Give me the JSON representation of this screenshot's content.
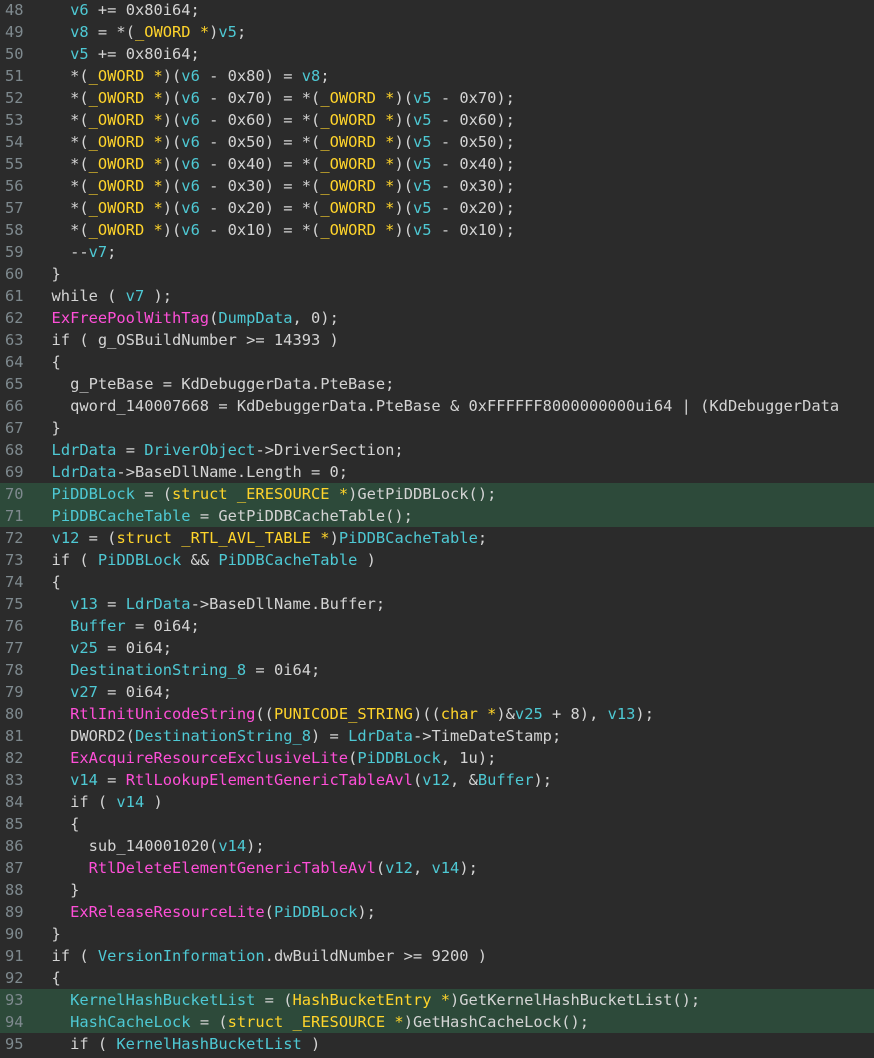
{
  "colors": {
    "background": "#2b2b2b",
    "highlight_row": "#2d4a3a",
    "line_number": "#7f8a8f",
    "plain": "#d4d4d4",
    "variable": "#4ec9d4",
    "global": "#33d4ff",
    "type": "#ffd42b",
    "function": "#ff4fd8"
  },
  "lines": [
    {
      "n": "48",
      "hl": false,
      "tokens": [
        [
          "p",
          "    "
        ],
        [
          "v",
          "v6"
        ],
        [
          "p",
          " += 0x80i64;"
        ]
      ]
    },
    {
      "n": "49",
      "hl": false,
      "tokens": [
        [
          "p",
          "    "
        ],
        [
          "v",
          "v8"
        ],
        [
          "p",
          " = *("
        ],
        [
          "t",
          "_OWORD *"
        ],
        [
          "p",
          ")"
        ],
        [
          "v",
          "v5"
        ],
        [
          "p",
          ";"
        ]
      ]
    },
    {
      "n": "50",
      "hl": false,
      "tokens": [
        [
          "p",
          "    "
        ],
        [
          "v",
          "v5"
        ],
        [
          "p",
          " += 0x80i64;"
        ]
      ]
    },
    {
      "n": "51",
      "hl": false,
      "tokens": [
        [
          "p",
          "    *("
        ],
        [
          "t",
          "_OWORD *"
        ],
        [
          "p",
          ")("
        ],
        [
          "v",
          "v6"
        ],
        [
          "p",
          " - 0x80) = "
        ],
        [
          "v",
          "v8"
        ],
        [
          "p",
          ";"
        ]
      ]
    },
    {
      "n": "52",
      "hl": false,
      "tokens": [
        [
          "p",
          "    *("
        ],
        [
          "t",
          "_OWORD *"
        ],
        [
          "p",
          ")("
        ],
        [
          "v",
          "v6"
        ],
        [
          "p",
          " - 0x70) = *("
        ],
        [
          "t",
          "_OWORD *"
        ],
        [
          "p",
          ")("
        ],
        [
          "v",
          "v5"
        ],
        [
          "p",
          " - 0x70);"
        ]
      ]
    },
    {
      "n": "53",
      "hl": false,
      "tokens": [
        [
          "p",
          "    *("
        ],
        [
          "t",
          "_OWORD *"
        ],
        [
          "p",
          ")("
        ],
        [
          "v",
          "v6"
        ],
        [
          "p",
          " - 0x60) = *("
        ],
        [
          "t",
          "_OWORD *"
        ],
        [
          "p",
          ")("
        ],
        [
          "v",
          "v5"
        ],
        [
          "p",
          " - 0x60);"
        ]
      ]
    },
    {
      "n": "54",
      "hl": false,
      "tokens": [
        [
          "p",
          "    *("
        ],
        [
          "t",
          "_OWORD *"
        ],
        [
          "p",
          ")("
        ],
        [
          "v",
          "v6"
        ],
        [
          "p",
          " - 0x50) = *("
        ],
        [
          "t",
          "_OWORD *"
        ],
        [
          "p",
          ")("
        ],
        [
          "v",
          "v5"
        ],
        [
          "p",
          " - 0x50);"
        ]
      ]
    },
    {
      "n": "55",
      "hl": false,
      "tokens": [
        [
          "p",
          "    *("
        ],
        [
          "t",
          "_OWORD *"
        ],
        [
          "p",
          ")("
        ],
        [
          "v",
          "v6"
        ],
        [
          "p",
          " - 0x40) = *("
        ],
        [
          "t",
          "_OWORD *"
        ],
        [
          "p",
          ")("
        ],
        [
          "v",
          "v5"
        ],
        [
          "p",
          " - 0x40);"
        ]
      ]
    },
    {
      "n": "56",
      "hl": false,
      "tokens": [
        [
          "p",
          "    *("
        ],
        [
          "t",
          "_OWORD *"
        ],
        [
          "p",
          ")("
        ],
        [
          "v",
          "v6"
        ],
        [
          "p",
          " - 0x30) = *("
        ],
        [
          "t",
          "_OWORD *"
        ],
        [
          "p",
          ")("
        ],
        [
          "v",
          "v5"
        ],
        [
          "p",
          " - 0x30);"
        ]
      ]
    },
    {
      "n": "57",
      "hl": false,
      "tokens": [
        [
          "p",
          "    *("
        ],
        [
          "t",
          "_OWORD *"
        ],
        [
          "p",
          ")("
        ],
        [
          "v",
          "v6"
        ],
        [
          "p",
          " - 0x20) = *("
        ],
        [
          "t",
          "_OWORD *"
        ],
        [
          "p",
          ")("
        ],
        [
          "v",
          "v5"
        ],
        [
          "p",
          " - 0x20);"
        ]
      ]
    },
    {
      "n": "58",
      "hl": false,
      "tokens": [
        [
          "p",
          "    *("
        ],
        [
          "t",
          "_OWORD *"
        ],
        [
          "p",
          ")("
        ],
        [
          "v",
          "v6"
        ],
        [
          "p",
          " - 0x10) = *("
        ],
        [
          "t",
          "_OWORD *"
        ],
        [
          "p",
          ")("
        ],
        [
          "v",
          "v5"
        ],
        [
          "p",
          " - 0x10);"
        ]
      ]
    },
    {
      "n": "59",
      "hl": false,
      "tokens": [
        [
          "p",
          "    --"
        ],
        [
          "v",
          "v7"
        ],
        [
          "p",
          ";"
        ]
      ]
    },
    {
      "n": "60",
      "hl": false,
      "tokens": [
        [
          "p",
          "  }"
        ]
      ]
    },
    {
      "n": "61",
      "hl": false,
      "tokens": [
        [
          "p",
          "  while ( "
        ],
        [
          "v",
          "v7"
        ],
        [
          "p",
          " );"
        ]
      ]
    },
    {
      "n": "62",
      "hl": false,
      "tokens": [
        [
          "p",
          "  "
        ],
        [
          "f",
          "ExFreePoolWithTag"
        ],
        [
          "p",
          "("
        ],
        [
          "v",
          "DumpData"
        ],
        [
          "p",
          ", 0);"
        ]
      ]
    },
    {
      "n": "63",
      "hl": false,
      "tokens": [
        [
          "p",
          "  if ( g_OSBuildNumber >= 14393 )"
        ]
      ]
    },
    {
      "n": "64",
      "hl": false,
      "tokens": [
        [
          "p",
          "  {"
        ]
      ]
    },
    {
      "n": "65",
      "hl": false,
      "tokens": [
        [
          "p",
          "    g_PteBase = KdDebuggerData.PteBase;"
        ]
      ]
    },
    {
      "n": "66",
      "hl": false,
      "tokens": [
        [
          "p",
          "    qword_140007668 = KdDebuggerData.PteBase & 0xFFFFFF8000000000ui64 | (KdDebuggerData"
        ]
      ]
    },
    {
      "n": "67",
      "hl": false,
      "tokens": [
        [
          "p",
          "  }"
        ]
      ]
    },
    {
      "n": "68",
      "hl": false,
      "tokens": [
        [
          "p",
          "  "
        ],
        [
          "v",
          "LdrData"
        ],
        [
          "p",
          " = "
        ],
        [
          "v",
          "DriverObject"
        ],
        [
          "p",
          "->DriverSection;"
        ]
      ]
    },
    {
      "n": "69",
      "hl": false,
      "tokens": [
        [
          "p",
          "  "
        ],
        [
          "v",
          "LdrData"
        ],
        [
          "p",
          "->BaseDllName.Length = 0;"
        ]
      ]
    },
    {
      "n": "70",
      "hl": true,
      "tokens": [
        [
          "p",
          "  "
        ],
        [
          "v",
          "PiDDBLock"
        ],
        [
          "p",
          " = ("
        ],
        [
          "t",
          "struct _ERESOURCE *"
        ],
        [
          "p",
          ")GetPiDDBLock();"
        ]
      ]
    },
    {
      "n": "71",
      "hl": true,
      "tokens": [
        [
          "p",
          "  "
        ],
        [
          "v",
          "PiDDBCacheTable"
        ],
        [
          "p",
          " = GetPiDDBCacheTable();"
        ]
      ]
    },
    {
      "n": "72",
      "hl": false,
      "tokens": [
        [
          "p",
          "  "
        ],
        [
          "v",
          "v12"
        ],
        [
          "p",
          " = ("
        ],
        [
          "t",
          "struct _RTL_AVL_TABLE *"
        ],
        [
          "p",
          ")"
        ],
        [
          "v",
          "PiDDBCacheTable"
        ],
        [
          "p",
          ";"
        ]
      ]
    },
    {
      "n": "73",
      "hl": false,
      "tokens": [
        [
          "p",
          "  if ( "
        ],
        [
          "v",
          "PiDDBLock"
        ],
        [
          "p",
          " && "
        ],
        [
          "v",
          "PiDDBCacheTable"
        ],
        [
          "p",
          " )"
        ]
      ]
    },
    {
      "n": "74",
      "hl": false,
      "tokens": [
        [
          "p",
          "  {"
        ]
      ]
    },
    {
      "n": "75",
      "hl": false,
      "tokens": [
        [
          "p",
          "    "
        ],
        [
          "v",
          "v13"
        ],
        [
          "p",
          " = "
        ],
        [
          "v",
          "LdrData"
        ],
        [
          "p",
          "->BaseDllName.Buffer;"
        ]
      ]
    },
    {
      "n": "76",
      "hl": false,
      "tokens": [
        [
          "p",
          "    "
        ],
        [
          "v",
          "Buffer"
        ],
        [
          "p",
          " = 0i64;"
        ]
      ]
    },
    {
      "n": "77",
      "hl": false,
      "tokens": [
        [
          "p",
          "    "
        ],
        [
          "v",
          "v25"
        ],
        [
          "p",
          " = 0i64;"
        ]
      ]
    },
    {
      "n": "78",
      "hl": false,
      "tokens": [
        [
          "p",
          "    "
        ],
        [
          "v",
          "DestinationString_8"
        ],
        [
          "p",
          " = 0i64;"
        ]
      ]
    },
    {
      "n": "79",
      "hl": false,
      "tokens": [
        [
          "p",
          "    "
        ],
        [
          "v",
          "v27"
        ],
        [
          "p",
          " = 0i64;"
        ]
      ]
    },
    {
      "n": "80",
      "hl": false,
      "tokens": [
        [
          "p",
          "    "
        ],
        [
          "f",
          "RtlInitUnicodeString"
        ],
        [
          "p",
          "(("
        ],
        [
          "t",
          "PUNICODE_STRING"
        ],
        [
          "p",
          ")(("
        ],
        [
          "t",
          "char *"
        ],
        [
          "p",
          ")&"
        ],
        [
          "v",
          "v25"
        ],
        [
          "p",
          " + 8), "
        ],
        [
          "v",
          "v13"
        ],
        [
          "p",
          ");"
        ]
      ]
    },
    {
      "n": "81",
      "hl": false,
      "tokens": [
        [
          "p",
          "    DWORD2("
        ],
        [
          "v",
          "DestinationString_8"
        ],
        [
          "p",
          ") = "
        ],
        [
          "v",
          "LdrData"
        ],
        [
          "p",
          "->TimeDateStamp;"
        ]
      ]
    },
    {
      "n": "82",
      "hl": false,
      "tokens": [
        [
          "p",
          "    "
        ],
        [
          "f",
          "ExAcquireResourceExclusiveLite"
        ],
        [
          "p",
          "("
        ],
        [
          "v",
          "PiDDBLock"
        ],
        [
          "p",
          ", 1u);"
        ]
      ]
    },
    {
      "n": "83",
      "hl": false,
      "tokens": [
        [
          "p",
          "    "
        ],
        [
          "v",
          "v14"
        ],
        [
          "p",
          " = "
        ],
        [
          "f",
          "RtlLookupElementGenericTableAvl"
        ],
        [
          "p",
          "("
        ],
        [
          "v",
          "v12"
        ],
        [
          "p",
          ", &"
        ],
        [
          "v",
          "Buffer"
        ],
        [
          "p",
          ");"
        ]
      ]
    },
    {
      "n": "84",
      "hl": false,
      "tokens": [
        [
          "p",
          "    if ( "
        ],
        [
          "v",
          "v14"
        ],
        [
          "p",
          " )"
        ]
      ]
    },
    {
      "n": "85",
      "hl": false,
      "tokens": [
        [
          "p",
          "    {"
        ]
      ]
    },
    {
      "n": "86",
      "hl": false,
      "tokens": [
        [
          "p",
          "      sub_140001020("
        ],
        [
          "v",
          "v14"
        ],
        [
          "p",
          ");"
        ]
      ]
    },
    {
      "n": "87",
      "hl": false,
      "tokens": [
        [
          "p",
          "      "
        ],
        [
          "f",
          "RtlDeleteElementGenericTableAvl"
        ],
        [
          "p",
          "("
        ],
        [
          "v",
          "v12"
        ],
        [
          "p",
          ", "
        ],
        [
          "v",
          "v14"
        ],
        [
          "p",
          ");"
        ]
      ]
    },
    {
      "n": "88",
      "hl": false,
      "tokens": [
        [
          "p",
          "    }"
        ]
      ]
    },
    {
      "n": "89",
      "hl": false,
      "tokens": [
        [
          "p",
          "    "
        ],
        [
          "f",
          "ExReleaseResourceLite"
        ],
        [
          "p",
          "("
        ],
        [
          "v",
          "PiDDBLock"
        ],
        [
          "p",
          ");"
        ]
      ]
    },
    {
      "n": "90",
      "hl": false,
      "tokens": [
        [
          "p",
          "  }"
        ]
      ]
    },
    {
      "n": "91",
      "hl": false,
      "tokens": [
        [
          "p",
          "  if ( "
        ],
        [
          "v",
          "VersionInformation"
        ],
        [
          "p",
          ".dwBuildNumber >= 9200 )"
        ]
      ]
    },
    {
      "n": "92",
      "hl": false,
      "tokens": [
        [
          "p",
          "  {"
        ]
      ]
    },
    {
      "n": "93",
      "hl": true,
      "tokens": [
        [
          "p",
          "    "
        ],
        [
          "v",
          "KernelHashBucketList"
        ],
        [
          "p",
          " = ("
        ],
        [
          "t",
          "HashBucketEntry *"
        ],
        [
          "p",
          ")GetKernelHashBucketList();"
        ]
      ]
    },
    {
      "n": "94",
      "hl": true,
      "tokens": [
        [
          "p",
          "    "
        ],
        [
          "v",
          "HashCacheLock"
        ],
        [
          "p",
          " = ("
        ],
        [
          "t",
          "struct _ERESOURCE *"
        ],
        [
          "p",
          ")GetHashCacheLock();"
        ]
      ]
    },
    {
      "n": "95",
      "hl": false,
      "tokens": [
        [
          "p",
          "    if ( "
        ],
        [
          "v",
          "KernelHashBucketList"
        ],
        [
          "p",
          " )"
        ]
      ]
    }
  ]
}
